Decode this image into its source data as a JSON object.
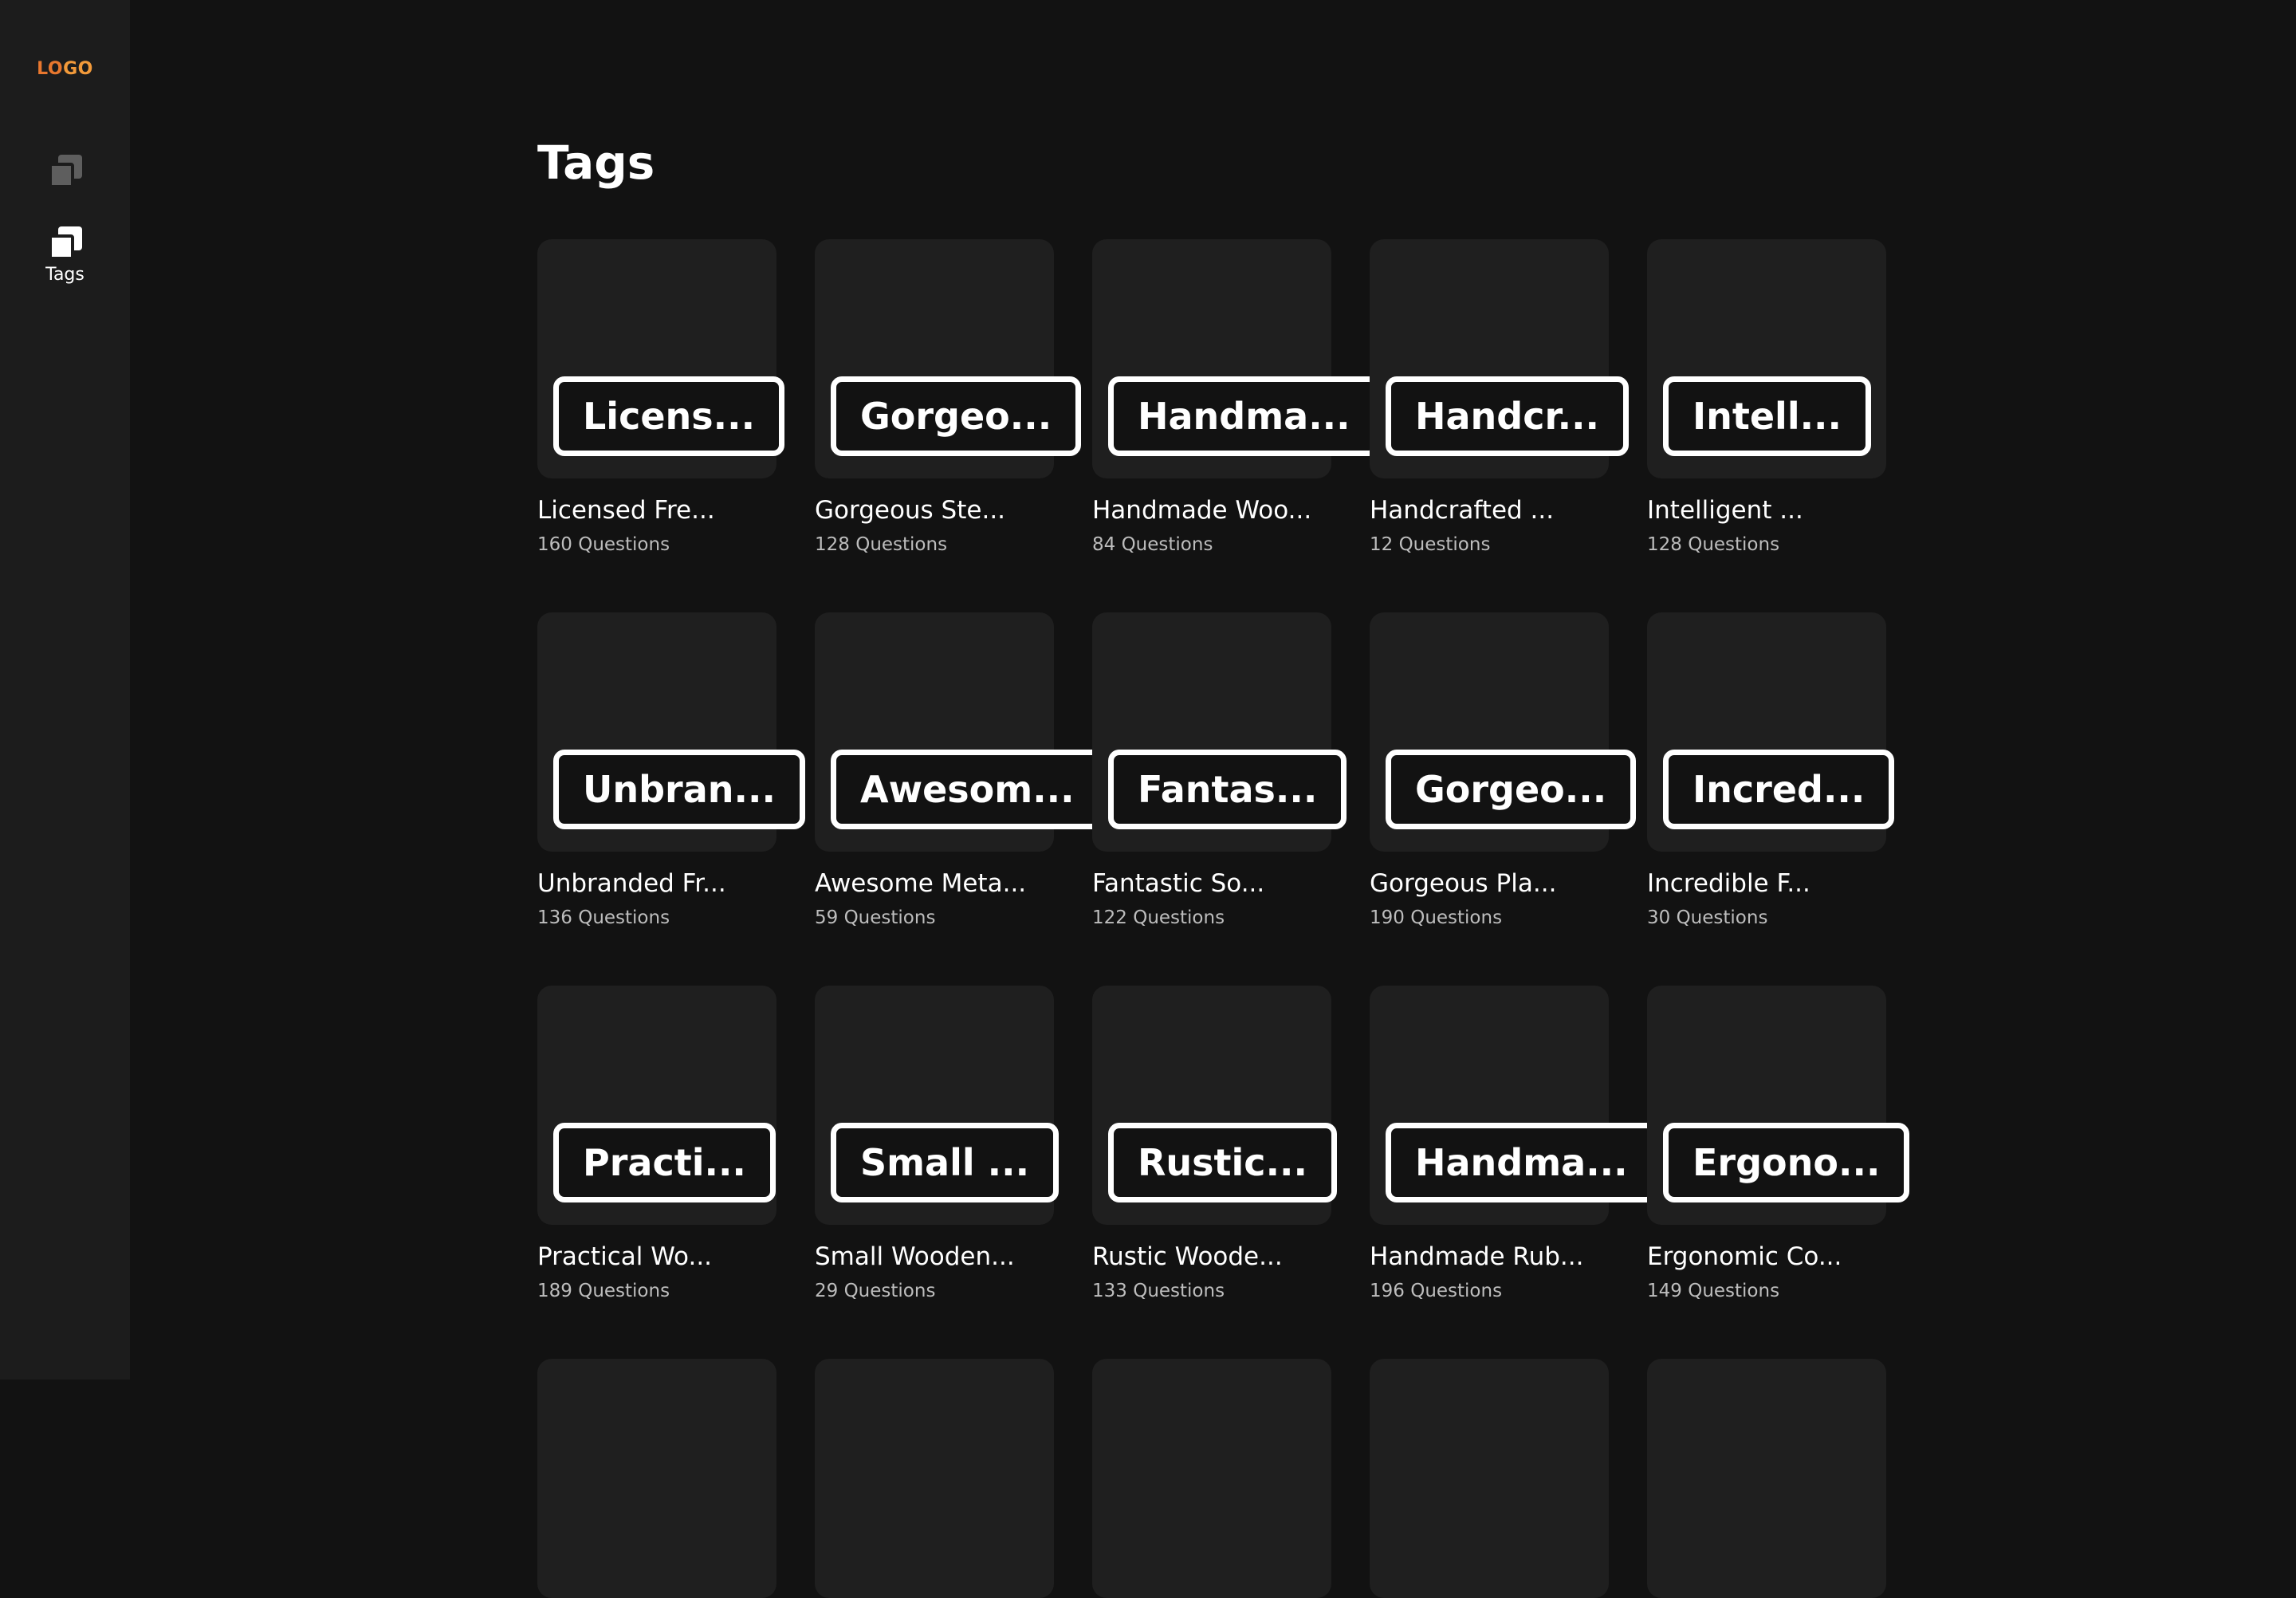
{
  "brand": {
    "logo_part1": "LO",
    "logo_part2": "GO",
    "logo_color_1": "#e8772e",
    "logo_color_2": "#f29a3a"
  },
  "sidebar": {
    "items": [
      {
        "label": "",
        "icon": "stack-icon",
        "active": false
      },
      {
        "label": "Tags",
        "icon": "stack-icon",
        "active": true
      }
    ]
  },
  "page": {
    "title": "Tags"
  },
  "tags": [
    {
      "chip": "Licens...",
      "name": "Licensed Fre...",
      "count": "160 Questions"
    },
    {
      "chip": "Gorgeo...",
      "name": "Gorgeous Ste...",
      "count": "128 Questions"
    },
    {
      "chip": "Handma...",
      "name": "Handmade Woo...",
      "count": "84 Questions"
    },
    {
      "chip": "Handcr...",
      "name": "Handcrafted ...",
      "count": "12 Questions"
    },
    {
      "chip": "Intell...",
      "name": "Intelligent ...",
      "count": "128 Questions"
    },
    {
      "chip": "Unbran...",
      "name": "Unbranded Fr...",
      "count": "136 Questions"
    },
    {
      "chip": "Awesom...",
      "name": "Awesome Meta...",
      "count": "59 Questions"
    },
    {
      "chip": "Fantas...",
      "name": "Fantastic So...",
      "count": "122 Questions"
    },
    {
      "chip": "Gorgeo...",
      "name": "Gorgeous Pla...",
      "count": "190 Questions"
    },
    {
      "chip": "Incred...",
      "name": "Incredible F...",
      "count": "30 Questions"
    },
    {
      "chip": "Practi...",
      "name": "Practical Wo...",
      "count": "189 Questions"
    },
    {
      "chip": "Small ...",
      "name": "Small Wooden...",
      "count": "29 Questions"
    },
    {
      "chip": "Rustic...",
      "name": "Rustic Woode...",
      "count": "133 Questions"
    },
    {
      "chip": "Handma...",
      "name": "Handmade Rub...",
      "count": "196 Questions"
    },
    {
      "chip": "Ergono...",
      "name": "Ergonomic Co...",
      "count": "149 Questions"
    }
  ]
}
